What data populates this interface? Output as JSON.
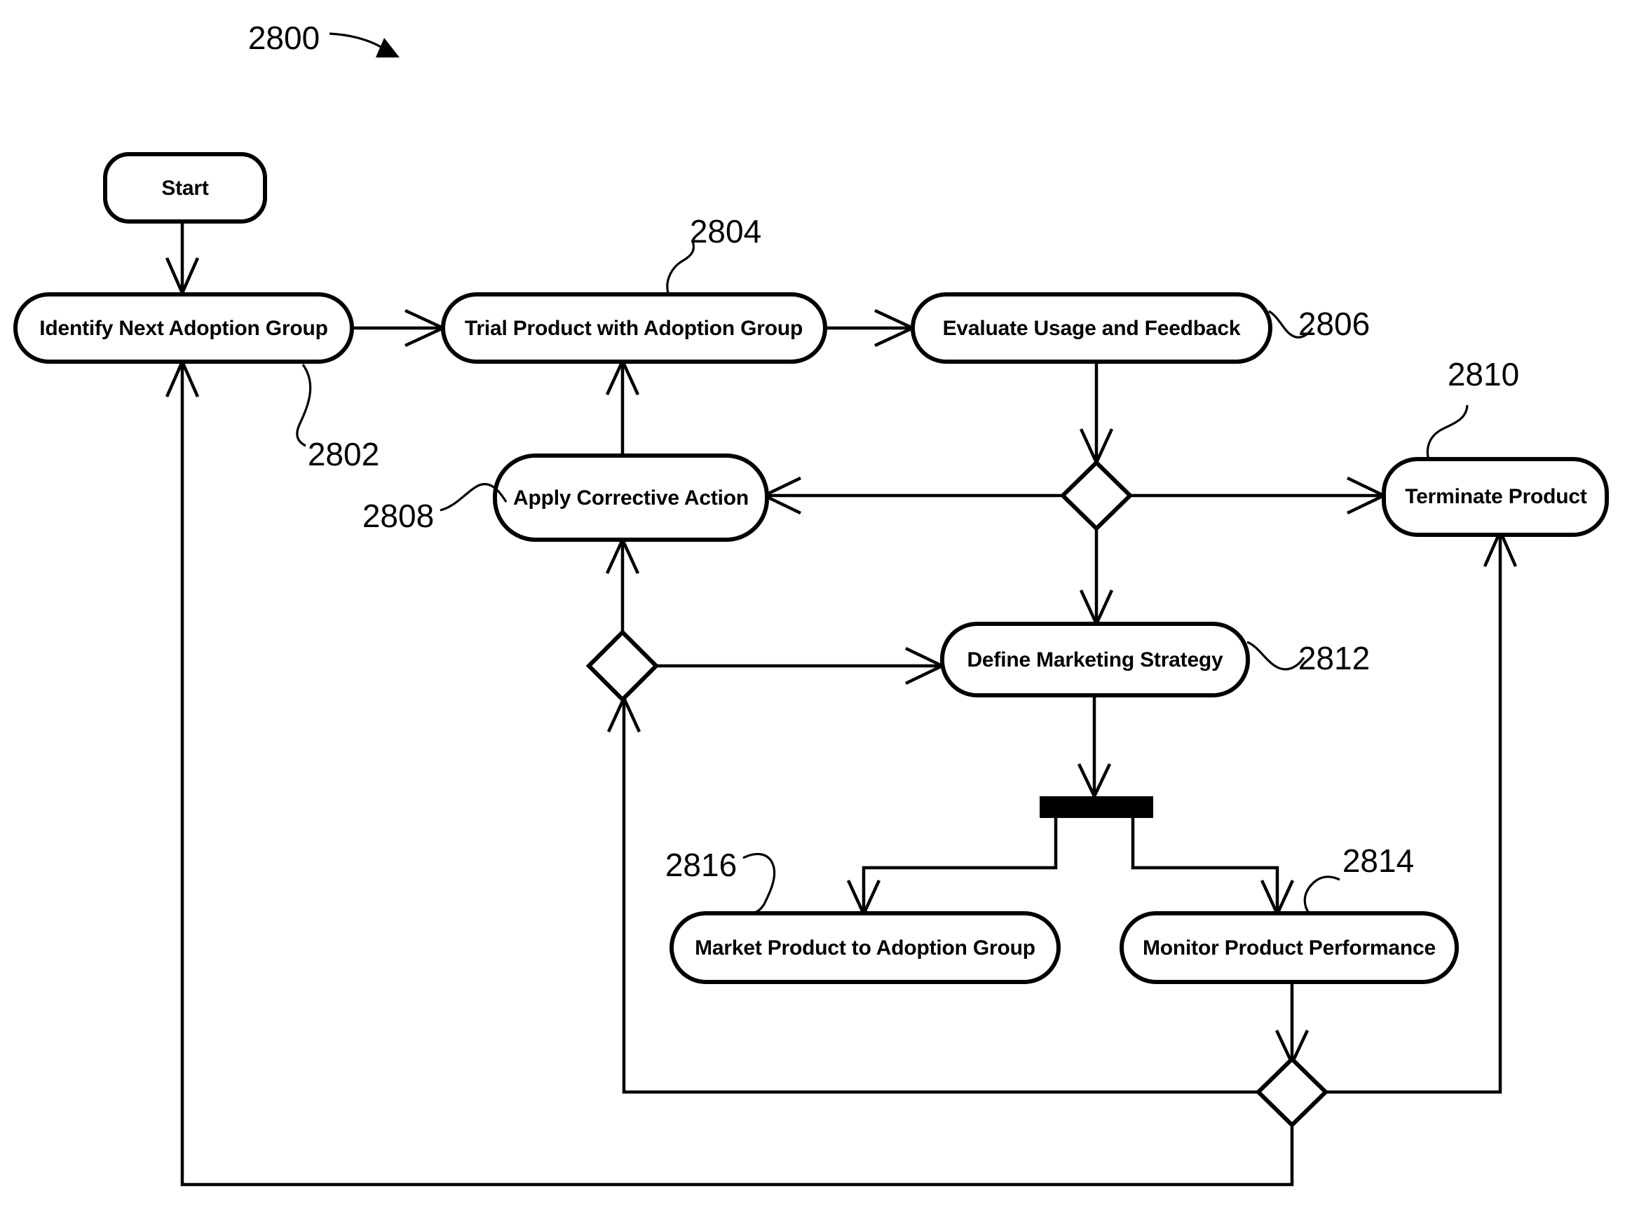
{
  "figure": {
    "figure_number": "2800",
    "type": "activity-flowchart"
  },
  "nodes": {
    "start": {
      "label": "Start"
    },
    "identify": {
      "label": "Identify Next Adoption Group",
      "ref": "2802"
    },
    "trial": {
      "label": "Trial Product with Adoption Group",
      "ref": "2804"
    },
    "evaluate": {
      "label": "Evaluate Usage and Feedback",
      "ref": "2806"
    },
    "corrective": {
      "label": "Apply Corrective Action",
      "ref": "2808"
    },
    "terminate": {
      "label": "Terminate Product",
      "ref": "2810"
    },
    "strategy": {
      "label": "Define Marketing Strategy",
      "ref": "2812"
    },
    "monitor": {
      "label": "Monitor Product Performance",
      "ref": "2814"
    },
    "market": {
      "label": "Market Product to Adoption Group",
      "ref": "2816"
    }
  },
  "refs": {
    "fig": "2800",
    "identify": "2802",
    "trial": "2804",
    "evaluate": "2806",
    "corrective": "2808",
    "terminate": "2810",
    "strategy": "2812",
    "monitor": "2814",
    "market": "2816"
  },
  "decisions": [
    {
      "name": "after-evaluate",
      "branches": [
        "to Apply Corrective Action",
        "to Terminate Product",
        "to Define Marketing Strategy"
      ]
    },
    {
      "name": "before-corrective",
      "branches": [
        "to Apply Corrective Action",
        "to Define Marketing Strategy"
      ]
    },
    {
      "name": "after-monitor",
      "branches": [
        "to Terminate Product",
        "to Apply Corrective Action",
        "to Identify Next Adoption Group"
      ]
    }
  ],
  "fork": {
    "name": "fork-bar",
    "outputs": [
      "Market Product to Adoption Group",
      "Monitor Product Performance"
    ]
  },
  "colors": {
    "stroke": "#000000",
    "fill": "#ffffff"
  }
}
